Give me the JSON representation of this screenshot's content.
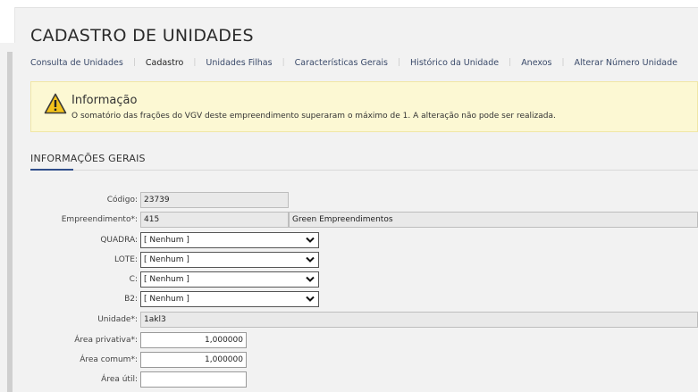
{
  "page": {
    "title": "CADASTRO DE UNIDADES"
  },
  "tabs": [
    {
      "label": "Consulta de Unidades",
      "active": false
    },
    {
      "label": "Cadastro",
      "active": true
    },
    {
      "label": "Unidades Filhas",
      "active": false
    },
    {
      "label": "Características Gerais",
      "active": false
    },
    {
      "label": "Histórico da Unidade",
      "active": false
    },
    {
      "label": "Anexos",
      "active": false
    },
    {
      "label": "Alterar Número Unidade",
      "active": false
    }
  ],
  "alert": {
    "icon": "warning-icon",
    "title": "Informação",
    "message": "O somatório das frações do VGV deste empreendimento superaram o máximo de 1. A alteração não pode ser realizada."
  },
  "section": {
    "title": "INFORMAÇÕES GERAIS"
  },
  "form": {
    "codigo": {
      "label": "Código:",
      "value": "23739"
    },
    "empreendimento": {
      "label": "Empreendimento*:",
      "value": "415",
      "name": "Green Empreendimentos"
    },
    "quadra": {
      "label": "QUADRA:",
      "value": "[ Nenhum ]"
    },
    "lote": {
      "label": "LOTE:",
      "value": "[ Nenhum ]"
    },
    "c": {
      "label": "C:",
      "value": "[ Nenhum ]"
    },
    "b2": {
      "label": "B2:",
      "value": "[ Nenhum ]"
    },
    "unidade": {
      "label": "Unidade*:",
      "value": "1akl3"
    },
    "area_privativa": {
      "label": "Área privativa*:",
      "value": "1,000000"
    },
    "area_comum": {
      "label": "Área comum*:",
      "value": "1,000000"
    },
    "area_util": {
      "label": "Área útil:",
      "value": ""
    }
  },
  "colors": {
    "alert_bg": "#fcf8d3",
    "accent": "#2f4e8a",
    "warning": "#f3c21b"
  }
}
